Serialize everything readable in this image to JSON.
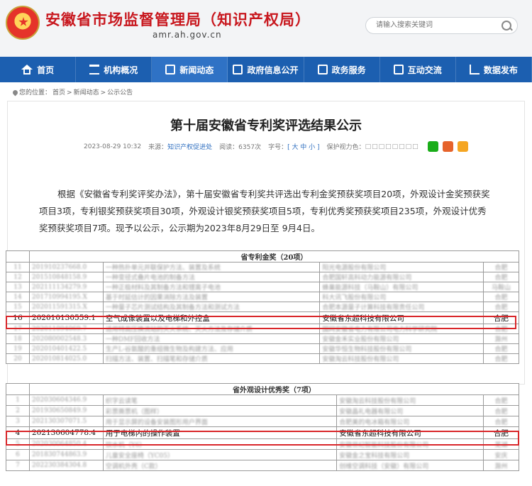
{
  "site": {
    "title": "安徽省市场监督管理局（知识产权局）",
    "domain": "amr.ah.gov.cn"
  },
  "search": {
    "placeholder": "请输入搜索关键词"
  },
  "nav": [
    {
      "label": "首页",
      "icon": "home-icon"
    },
    {
      "label": "机构概况",
      "icon": "building-icon"
    },
    {
      "label": "新闻动态",
      "icon": "news-icon"
    },
    {
      "label": "政府信息公开",
      "icon": "document-icon"
    },
    {
      "label": "政务服务",
      "icon": "service-icon"
    },
    {
      "label": "互动交流",
      "icon": "chat-icon"
    },
    {
      "label": "数据发布",
      "icon": "chart-icon"
    }
  ],
  "breadcrumb": {
    "prefix": "您的位置：",
    "items": [
      "首页",
      "新闻动态",
      "公示公告"
    ],
    "separator": ">"
  },
  "article": {
    "title": "第十届安徽省专利奖评选结果公示",
    "date": "2023-08-29 10:32",
    "source_label": "来源：",
    "source": "知识产权促进处",
    "views_label": "阅读：",
    "views": "6357次",
    "font_label": "字号：",
    "font_options": "[ 大 中 小 ]",
    "vision_label": "保护视力色：",
    "vision_swatches": "□□□□□□□□",
    "body": "根据《安徽省专利奖评奖办法》，第十届安徽省专利奖共评选出专利金奖预获奖项目20项，外观设计金奖预获奖项目3项，专利银奖预获奖项目30项，外观设计银奖预获奖项目5项，专利优秀奖预获奖项目235项，外观设计优秀奖预获奖项目7项。现予以公示，公示期为2023年8月29日至 9月4日。"
  },
  "table_gold": {
    "caption": "省专利金奖（20项）",
    "rows": [
      [
        "11",
        "201910237668.0",
        "一种热扑单元并联保护方法、装置及系统",
        "阳光电源股份有限公司",
        "合肥"
      ],
      [
        "12",
        "201510848158.9",
        "一种变径式叠片电池的制备方法",
        "合肥国轩高科动力能源有限公司",
        "合肥"
      ],
      [
        "13",
        "202111134279.9",
        "一种正极材料及其制备方法和锂离子电池",
        "蜂巢能源科技（马鞍山）有限公司",
        "马鞍山"
      ],
      [
        "14",
        "201710994195.X",
        "基于时延估计的因果消除方法及装置",
        "科大讯飞股份有限公司",
        "合肥"
      ],
      [
        "15",
        "202011591315.X",
        "一种量子芯片测试结构及其制备方法和测试方法",
        "合肥本源量子计算科技有限责任公司",
        "合肥"
      ],
      [
        "16",
        "202010130559.1",
        "空气成像装置以及电梯和外控盒",
        "安徽省东超科技有限公司",
        "合肥"
      ],
      [
        "17",
        "202011094069.7",
        "适用特高压换流站的灭火系统、灭火方法及存储介质",
        "国网安徽省电力有限公司电力科学研究院",
        "合肥"
      ],
      [
        "18",
        "202080002548.3",
        "一种DMF回收方法",
        "安徽金禾实业股份有限公司",
        "滁州"
      ],
      [
        "19",
        "202010401422.5",
        "生产L-谷氨酸的重组微生物及构建方法、应用",
        "安徽华恒生物科技股份有限公司",
        "合肥"
      ],
      [
        "20",
        "202010814025.0",
        "扫描方法、装置、扫描笔和存储介质",
        "安徽淘云科技股份有限公司",
        "合肥"
      ]
    ]
  },
  "table_design": {
    "caption": "省外观设计优秀奖（7项）",
    "rows": [
      [
        "1",
        "202030604346.9",
        "织字云读笔",
        "安徽淘云科技股份有限公司",
        "合肥"
      ],
      [
        "2",
        "201930650849.9",
        "彩票撕票机（图样）",
        "安徽晶礼电器有限公司",
        "合肥"
      ],
      [
        "3",
        "202130307071.5",
        "用于显示屏的设备安装图形用户界面",
        "合肥美的电冰箱有限公司",
        "合肥"
      ],
      [
        "4",
        "202130604778.4",
        "用于电梯内的操作装置",
        "安徽省东超科技有限公司",
        "合肥"
      ],
      [
        "5",
        "202030064850.4",
        "饮水机（Y6）",
        "安徽世纪智能科技股份有限公司",
        "芜湖"
      ],
      [
        "6",
        "201830744863.9",
        "儿童安全座椅（YC05）",
        "安徽金之宝科技有限公司",
        "安庆"
      ],
      [
        "7",
        "202230384304.8",
        "空调机外壳（C款）",
        "创维空调科技（安徽）有限公司",
        "滁州"
      ]
    ]
  },
  "colors": {
    "brand_red": "#c8171e",
    "nav_blue": "#1c5fb0",
    "highlight_red": "#d9262a"
  }
}
